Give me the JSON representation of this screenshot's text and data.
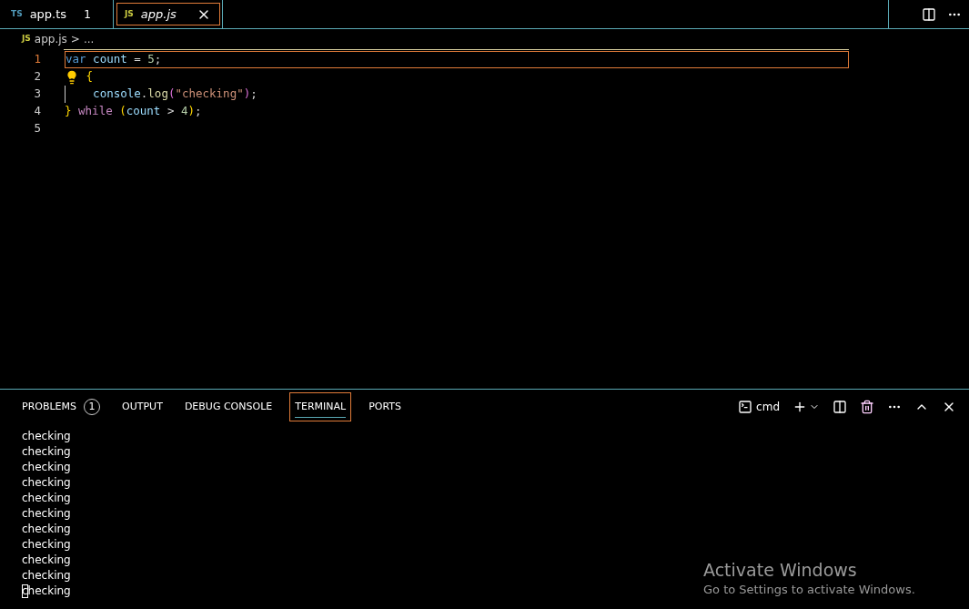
{
  "tabs": [
    {
      "badge": "TS",
      "label": "app.ts",
      "count": "1",
      "italic": false,
      "selected": false,
      "closable": false
    },
    {
      "badge": "JS",
      "label": "app.js",
      "italic": true,
      "selected": true,
      "closable": true
    }
  ],
  "breadcrumb": {
    "badge": "JS",
    "file": "app.js",
    "separator": ">",
    "rest": "..."
  },
  "editor": {
    "lines": [
      {
        "number": "1",
        "current": true,
        "lightbulb": false,
        "guide": false,
        "tokens": [
          {
            "kind": "keyword",
            "text": "var"
          },
          {
            "kind": "variable",
            "text": " count"
          },
          {
            "kind": "plain",
            "text": " ="
          },
          {
            "kind": "number",
            "text": " 5"
          },
          {
            "kind": "plain",
            "text": ";"
          }
        ]
      },
      {
        "number": "2",
        "current": false,
        "lightbulb": true,
        "guide": false,
        "tokens": [
          {
            "kind": "bracket1",
            "text": " {"
          }
        ]
      },
      {
        "number": "3",
        "current": false,
        "lightbulb": false,
        "guide": true,
        "tokens": [
          {
            "kind": "variable",
            "text": "    console"
          },
          {
            "kind": "plain",
            "text": "."
          },
          {
            "kind": "function",
            "text": "log"
          },
          {
            "kind": "bracket2",
            "text": "("
          },
          {
            "kind": "string",
            "text": "\"checking\""
          },
          {
            "kind": "bracket2",
            "text": ")"
          },
          {
            "kind": "plain",
            "text": ";"
          }
        ]
      },
      {
        "number": "4",
        "current": false,
        "lightbulb": false,
        "guide": false,
        "tokens": [
          {
            "kind": "bracket1",
            "text": "}"
          },
          {
            "kind": "control",
            "text": " while"
          },
          {
            "kind": "bracket1",
            "text": " ("
          },
          {
            "kind": "variable",
            "text": "count"
          },
          {
            "kind": "plain",
            "text": " >"
          },
          {
            "kind": "number",
            "text": " 4"
          },
          {
            "kind": "bracket1",
            "text": ")"
          },
          {
            "kind": "plain",
            "text": ";"
          }
        ]
      },
      {
        "number": "5",
        "current": false
      }
    ]
  },
  "panel": {
    "tabs": [
      {
        "label": "PROBLEMS",
        "badge": "1",
        "selected": false
      },
      {
        "label": "OUTPUT",
        "selected": false
      },
      {
        "label": "DEBUG CONSOLE",
        "selected": false
      },
      {
        "label": "TERMINAL",
        "selected": true
      },
      {
        "label": "PORTS",
        "selected": false
      }
    ],
    "shell": "cmd",
    "terminal": {
      "lines": [
        "checking",
        "checking",
        "checking",
        "checking",
        "checking",
        "checking",
        "checking",
        "checking",
        "checking",
        "checking",
        "checking"
      ],
      "cursor": true
    }
  },
  "activation": {
    "title": "Activate Windows",
    "subtitle": "Go to Settings to activate Windows."
  }
}
